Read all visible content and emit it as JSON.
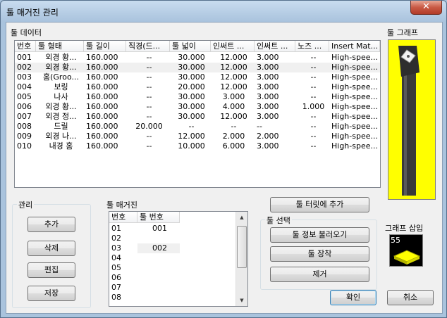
{
  "window": {
    "title": "툴 매거진 관리",
    "close_symbol": "✕"
  },
  "tool_data": {
    "label": "툴 데이터",
    "columns": [
      "번호",
      "툴 형태",
      "툴 길이",
      "직경(드...",
      "툴 넓이",
      "인써트 ...",
      "인써트 ...",
      "노즈 ...",
      "Insert Mat..."
    ],
    "rows": [
      [
        "001",
        "외경 황...",
        "160.000",
        "--",
        "30.000",
        "12.000",
        "3.000",
        "--",
        "High-spee..."
      ],
      [
        "002",
        "외경 황...",
        "160.000",
        "--",
        "30.000",
        "12.000",
        "3.000",
        "--",
        "High-spee..."
      ],
      [
        "003",
        "홈(Groo...",
        "160.000",
        "--",
        "30.000",
        "12.000",
        "3.000",
        "--",
        "High-spee..."
      ],
      [
        "004",
        "보링",
        "160.000",
        "--",
        "20.000",
        "12.000",
        "3.000",
        "--",
        "High-spee..."
      ],
      [
        "005",
        "나사",
        "160.000",
        "--",
        "30.000",
        "3.000",
        "3.000",
        "--",
        "High-spee..."
      ],
      [
        "006",
        "외경 황...",
        "160.000",
        "--",
        "30.000",
        "4.000",
        "3.000",
        "1.000",
        "High-spee..."
      ],
      [
        "007",
        "외경 정...",
        "160.000",
        "--",
        "30.000",
        "12.000",
        "3.000",
        "--",
        "High-spee..."
      ],
      [
        "008",
        "드릴",
        "160.000",
        "20.000",
        "--",
        "--",
        "--",
        "--",
        "High-spee..."
      ],
      [
        "009",
        "외경 나...",
        "160.000",
        "--",
        "12.000",
        "2.000",
        "2.000",
        "--",
        "High-spee..."
      ],
      [
        "010",
        "내경 홈",
        "160.000",
        "--",
        "10.000",
        "6.000",
        "3.000",
        "--",
        "High-spee..."
      ]
    ]
  },
  "tool_graph": {
    "label": "툴 그래프",
    "background": "#ffff00"
  },
  "management": {
    "label": "관리",
    "add": "추가",
    "delete": "삭제",
    "edit": "편집",
    "save": "저장"
  },
  "magazine": {
    "label": "툴 매거진",
    "columns": [
      "번호",
      "툴 번호"
    ],
    "rows": [
      [
        "01",
        "001"
      ],
      [
        "02",
        ""
      ],
      [
        "03",
        "002"
      ],
      [
        "04",
        ""
      ],
      [
        "05",
        ""
      ],
      [
        "06",
        ""
      ],
      [
        "07",
        ""
      ],
      [
        "08",
        ""
      ]
    ]
  },
  "add_turret_button": "툴 터릿에 추가",
  "tool_select": {
    "label": "툴 선택",
    "load_info": "툴 정보 불러오기",
    "mount": "툴 장착",
    "remove": "제거"
  },
  "graph_insert": {
    "label": "그래프 삽입",
    "number": "55"
  },
  "footer": {
    "ok": "확인",
    "cancel": "취소"
  }
}
